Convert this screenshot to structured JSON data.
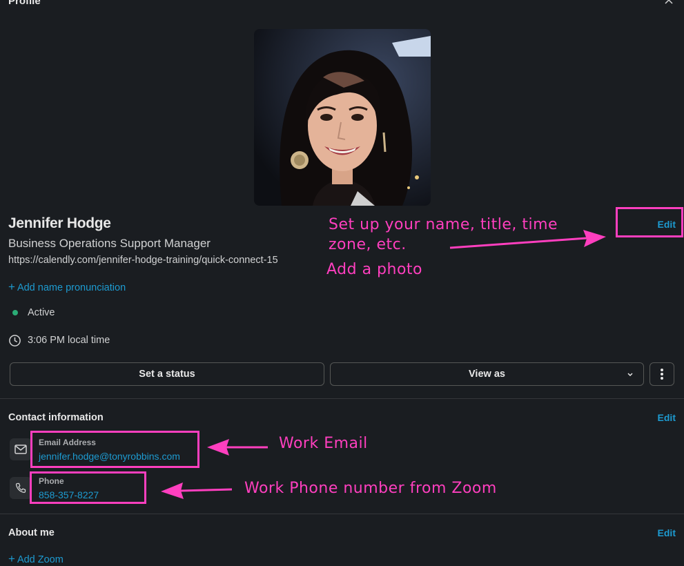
{
  "header": {
    "title": "Profile"
  },
  "profile": {
    "name": "Jennifer Hodge",
    "job_title": "Business Operations Support Manager",
    "url": "https://calendly.com/jennifer-hodge-training/quick-connect-15",
    "add_pronunciation": "Add name pronunciation",
    "status": "Active",
    "local_time": "3:06 PM local time",
    "edit_label": "Edit"
  },
  "actions": {
    "set_status": "Set a status",
    "view_as": "View as"
  },
  "contact": {
    "heading": "Contact information",
    "edit_label": "Edit",
    "email_label": "Email Address",
    "email": "jennifer.hodge@tonyrobbins.com",
    "phone_label": "Phone",
    "phone": "858-357-8227"
  },
  "about": {
    "heading": "About me",
    "edit_label": "Edit",
    "add_zoom": "Add Zoom"
  },
  "annotations": {
    "name_note": "Set up your name, title, time zone, etc.",
    "photo_note": "Add a photo",
    "email_note": "Work Email",
    "phone_note": "Work Phone number from Zoom"
  },
  "colors": {
    "background": "#1a1d21",
    "link": "#1d9bd1",
    "active": "#2bac76",
    "annotation": "#ff3fbf"
  }
}
